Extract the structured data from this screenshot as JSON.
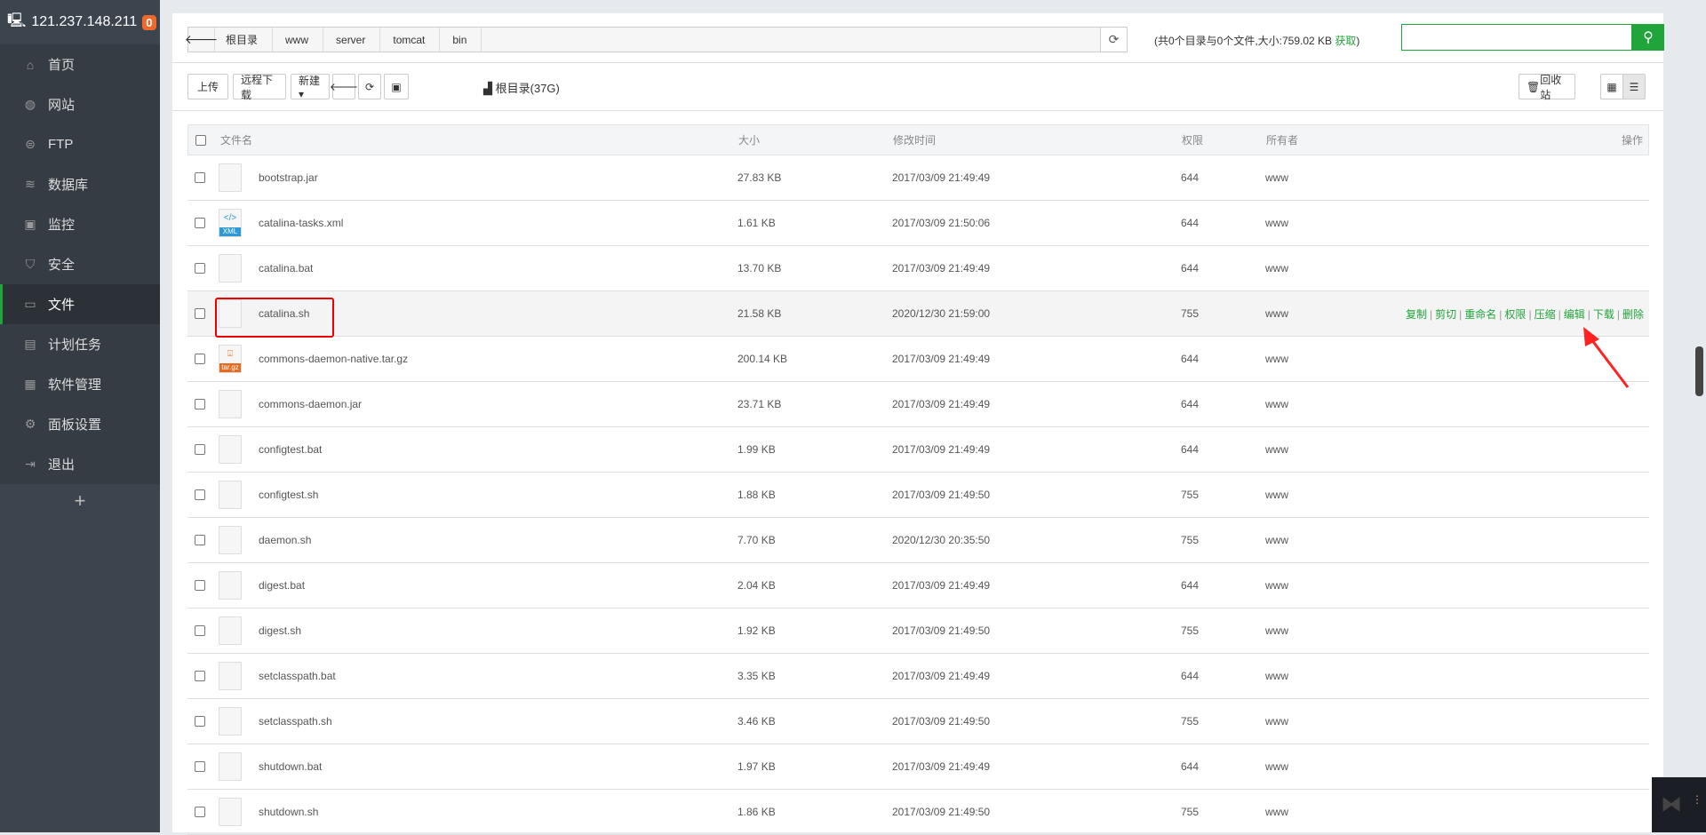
{
  "sidebar": {
    "host": "121.237.148.211",
    "badge": "0",
    "items": [
      {
        "label": "首页",
        "icon": "home-icon"
      },
      {
        "label": "网站",
        "icon": "globe-icon"
      },
      {
        "label": "FTP",
        "icon": "ftp-icon"
      },
      {
        "label": "数据库",
        "icon": "database-icon"
      },
      {
        "label": "监控",
        "icon": "monitor-icon"
      },
      {
        "label": "安全",
        "icon": "shield-icon"
      },
      {
        "label": "文件",
        "icon": "folder-icon",
        "active": true
      },
      {
        "label": "计划任务",
        "icon": "calendar-icon"
      },
      {
        "label": "软件管理",
        "icon": "apps-icon"
      },
      {
        "label": "面板设置",
        "icon": "gear-icon"
      },
      {
        "label": "退出",
        "icon": "logout-icon"
      }
    ],
    "add": "+"
  },
  "breadcrumb": [
    "根目录",
    "www",
    "server",
    "tomcat",
    "bin"
  ],
  "dirinfo": {
    "text": "(共0个目录与0个文件,大小:759.02 KB ",
    "get": "获取",
    "close": ")"
  },
  "search": {
    "placeholder": ""
  },
  "toolbar": {
    "upload": "上传",
    "remote_download": "远程下载",
    "new": "新建 ▾",
    "root_disk": "根目录(37G)",
    "recycle": "回收站"
  },
  "table": {
    "headers": {
      "name": "文件名",
      "size": "大小",
      "mtime": "修改时间",
      "perm": "权限",
      "owner": "所有者",
      "ops": "操作"
    },
    "ops": [
      "复制",
      "剪切",
      "重命名",
      "权限",
      "压缩",
      "编辑",
      "下载",
      "删除"
    ],
    "rows": [
      {
        "name": "bootstrap.jar",
        "size": "27.83 KB",
        "mtime": "2017/03/09 21:49:49",
        "perm": "644",
        "owner": "www",
        "type": "file"
      },
      {
        "name": "catalina-tasks.xml",
        "size": "1.61 KB",
        "mtime": "2017/03/09 21:50:06",
        "perm": "644",
        "owner": "www",
        "type": "xml"
      },
      {
        "name": "catalina.bat",
        "size": "13.70 KB",
        "mtime": "2017/03/09 21:49:49",
        "perm": "644",
        "owner": "www",
        "type": "file"
      },
      {
        "name": "catalina.sh",
        "size": "21.58 KB",
        "mtime": "2020/12/30 21:59:00",
        "perm": "755",
        "owner": "www",
        "type": "file",
        "highlighted": true
      },
      {
        "name": "commons-daemon-native.tar.gz",
        "size": "200.14 KB",
        "mtime": "2017/03/09 21:49:49",
        "perm": "644",
        "owner": "www",
        "type": "gz"
      },
      {
        "name": "commons-daemon.jar",
        "size": "23.71 KB",
        "mtime": "2017/03/09 21:49:49",
        "perm": "644",
        "owner": "www",
        "type": "file"
      },
      {
        "name": "configtest.bat",
        "size": "1.99 KB",
        "mtime": "2017/03/09 21:49:49",
        "perm": "644",
        "owner": "www",
        "type": "file"
      },
      {
        "name": "configtest.sh",
        "size": "1.88 KB",
        "mtime": "2017/03/09 21:49:50",
        "perm": "755",
        "owner": "www",
        "type": "file"
      },
      {
        "name": "daemon.sh",
        "size": "7.70 KB",
        "mtime": "2020/12/30 20:35:50",
        "perm": "755",
        "owner": "www",
        "type": "file"
      },
      {
        "name": "digest.bat",
        "size": "2.04 KB",
        "mtime": "2017/03/09 21:49:49",
        "perm": "644",
        "owner": "www",
        "type": "file"
      },
      {
        "name": "digest.sh",
        "size": "1.92 KB",
        "mtime": "2017/03/09 21:49:50",
        "perm": "755",
        "owner": "www",
        "type": "file"
      },
      {
        "name": "setclasspath.bat",
        "size": "3.35 KB",
        "mtime": "2017/03/09 21:49:49",
        "perm": "644",
        "owner": "www",
        "type": "file"
      },
      {
        "name": "setclasspath.sh",
        "size": "3.46 KB",
        "mtime": "2017/03/09 21:49:50",
        "perm": "755",
        "owner": "www",
        "type": "file"
      },
      {
        "name": "shutdown.bat",
        "size": "1.97 KB",
        "mtime": "2017/03/09 21:49:49",
        "perm": "644",
        "owner": "www",
        "type": "file"
      },
      {
        "name": "shutdown.sh",
        "size": "1.86 KB",
        "mtime": "2017/03/09 21:49:50",
        "perm": "755",
        "owner": "www",
        "type": "file"
      }
    ]
  },
  "colors": {
    "accent": "#20a53a",
    "sidebar": "#3c444d",
    "badge": "#f0692a",
    "annotation": "#ee0000"
  }
}
